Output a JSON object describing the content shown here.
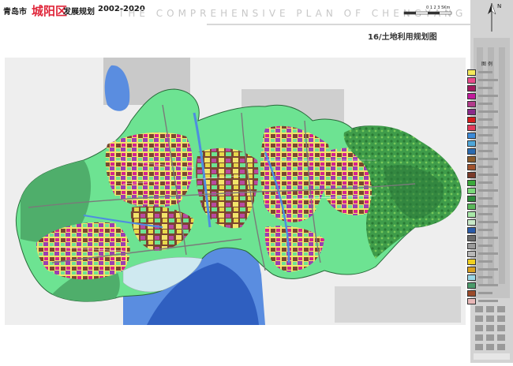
{
  "header": {
    "city": "青岛市",
    "district": "城阳区",
    "plan": "发展规划",
    "years": "2002-2020",
    "banner": "THE COMPREHENSIVE PLAN OF CHENGYANG DISTRICT"
  },
  "sheet_title": "16/土地利用规划图",
  "legend": {
    "title": "图 例",
    "swatches": [
      "#f4e95a",
      "#e84a8a",
      "#a1195e",
      "#c21a9c",
      "#b23a8a",
      "#8a2a8a",
      "#d41c1c",
      "#e33a5a",
      "#3a8ad8",
      "#4ea6d8",
      "#2a6ab0",
      "#8a5a2a",
      "#a0522d",
      "#7a3a2a",
      "#3aa83a",
      "#7ad87a",
      "#2a8a3a",
      "#5ab85a",
      "#a8e8a8",
      "#c8e8c8",
      "#2a5aa8",
      "#6a6a6a",
      "#9a9a9a",
      "#b8b8b8",
      "#f0d020",
      "#d8a020",
      "#9ad8e8",
      "#4a9a6a",
      "#9a4a2a",
      "#e8b8b8"
    ]
  },
  "scale_label": "0 1 2 3 5Km",
  "north_label": "N",
  "colors": {
    "residential": "#f4e95a",
    "industrial": "#7a4530",
    "green": "#6de392",
    "water": "#5a8de0",
    "commercial": "#d8208a",
    "rural": "#4fae6b",
    "public": "#9b3fb0"
  }
}
